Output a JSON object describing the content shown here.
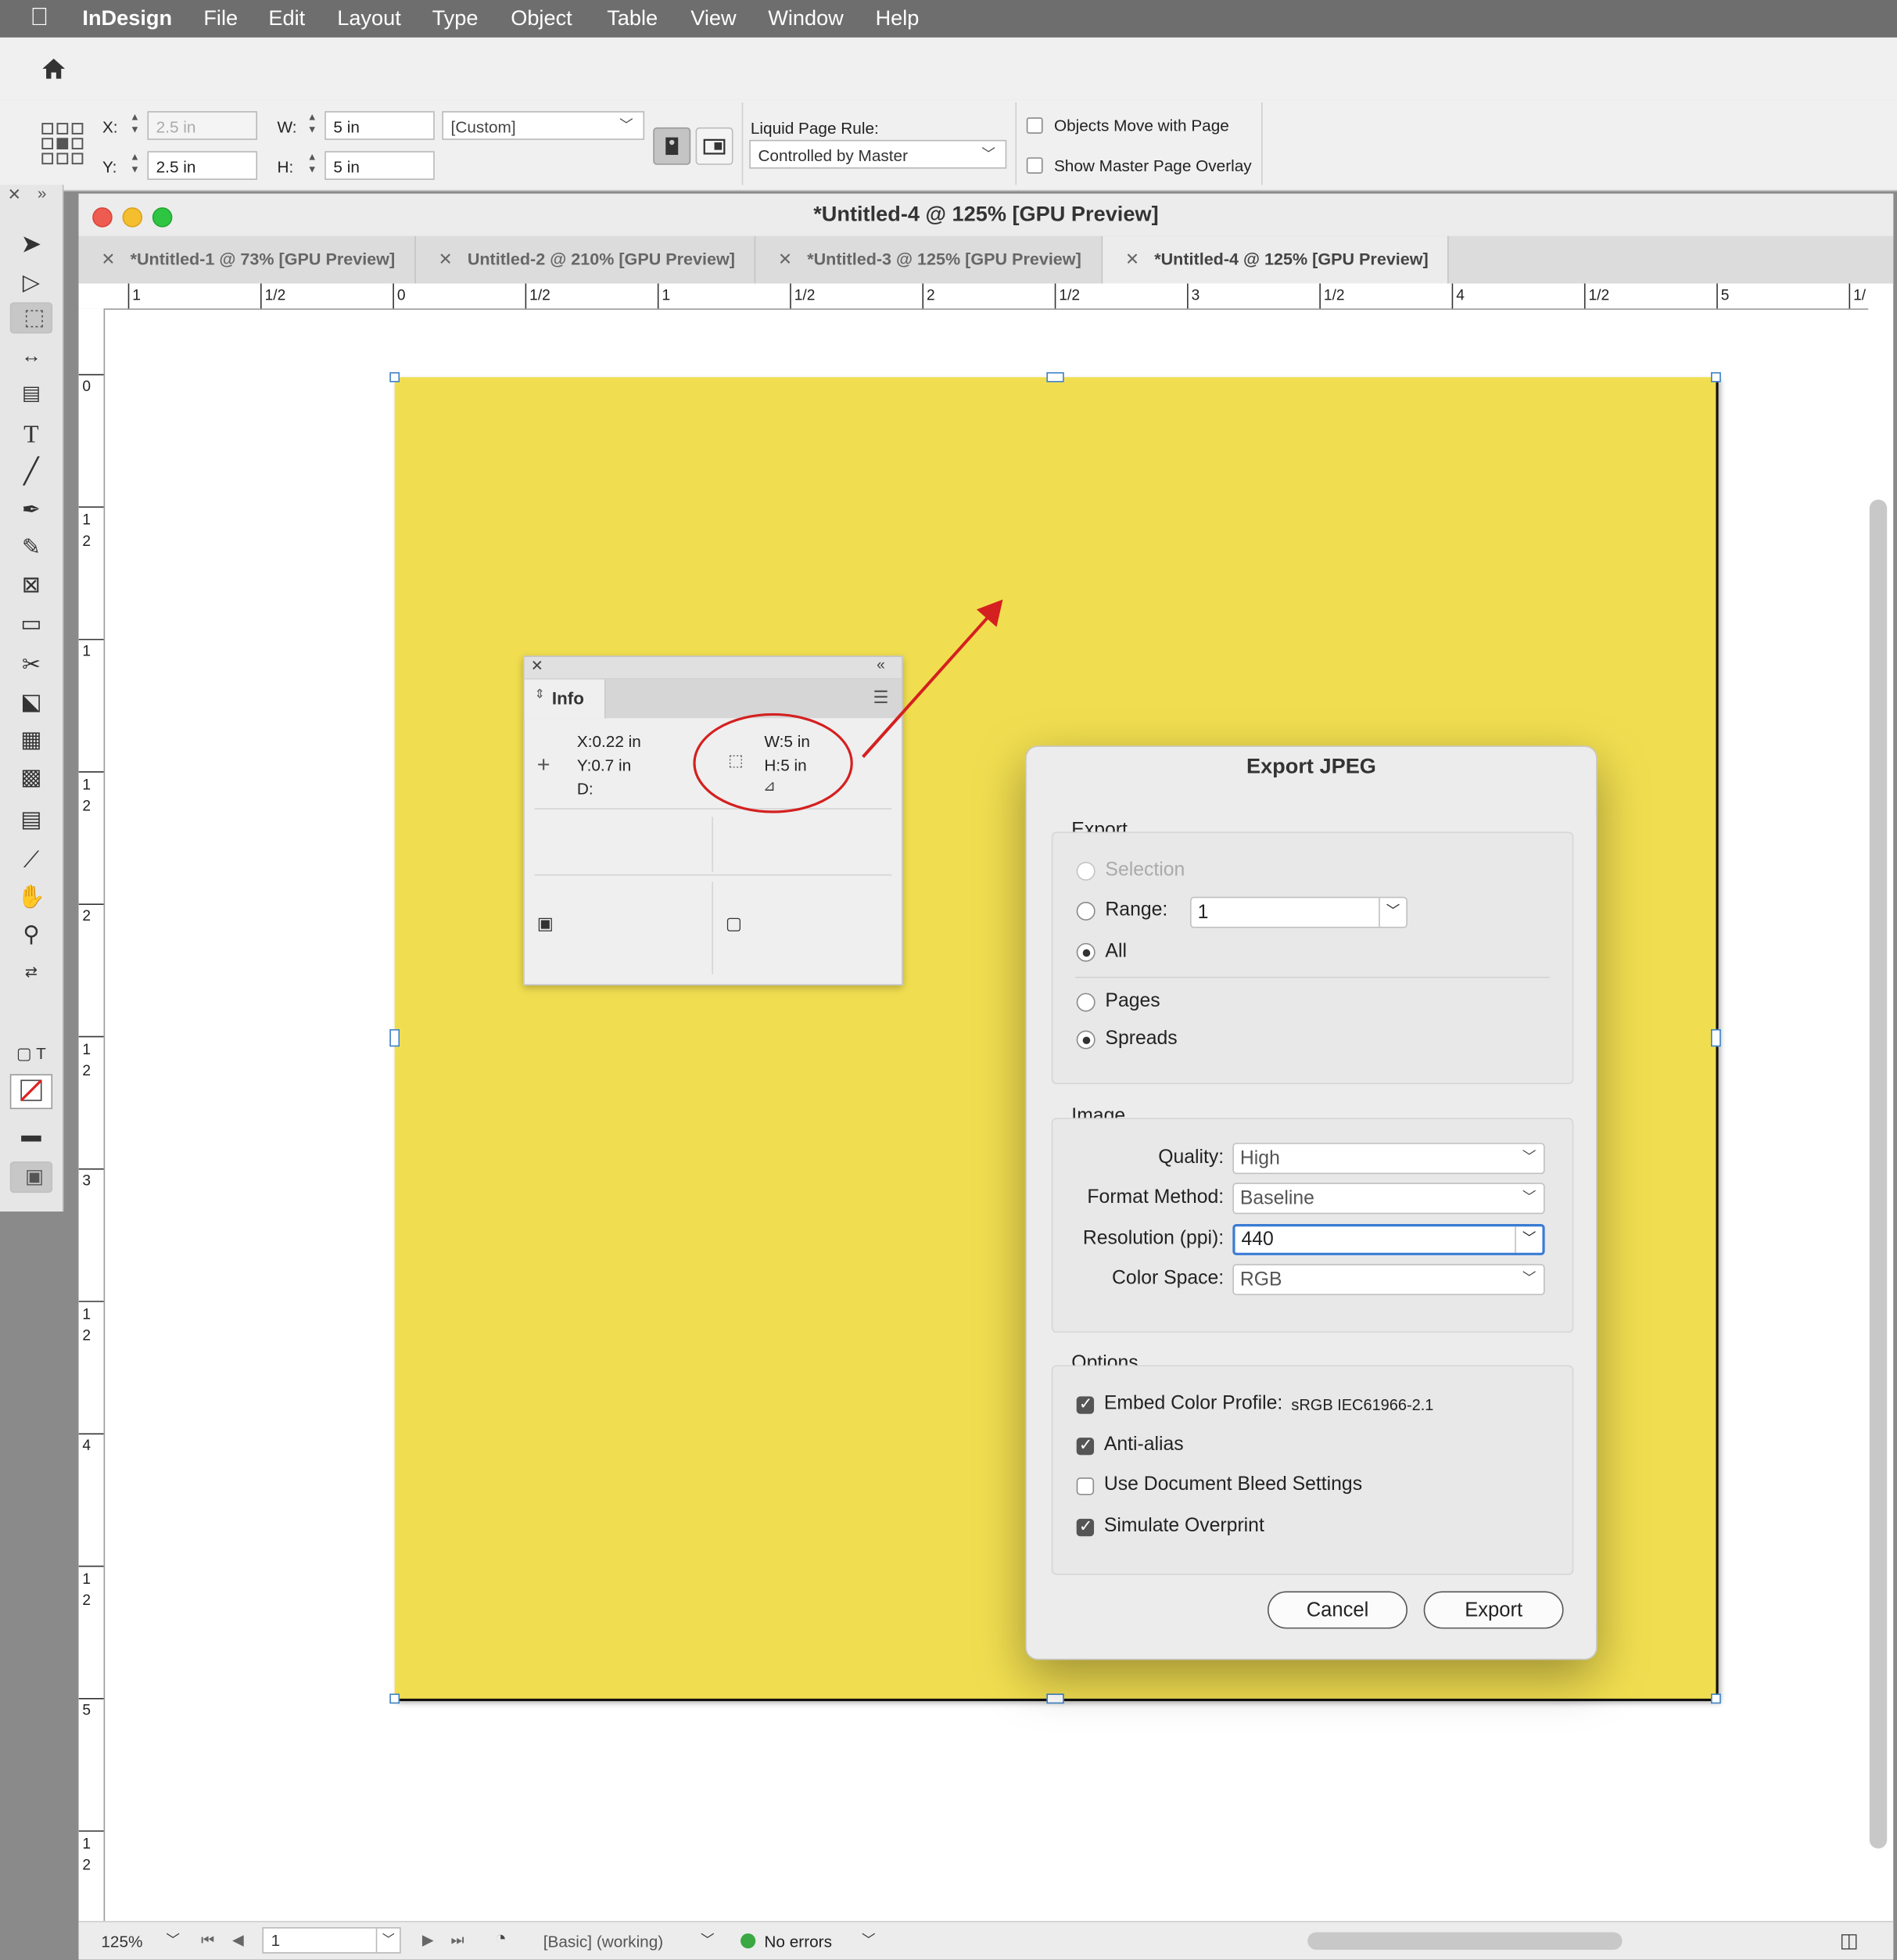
{
  "menubar": {
    "apple": "",
    "items": [
      "InDesign",
      "File",
      "Edit",
      "Layout",
      "Type",
      "Object",
      "Table",
      "View",
      "Window",
      "Help"
    ]
  },
  "controls": {
    "x_label": "X:",
    "x_value": "2.5 in",
    "y_label": "Y:",
    "y_value": "2.5 in",
    "w_label": "W:",
    "w_value": "5 in",
    "h_label": "H:",
    "h_value": "5 in",
    "size_preset": "[Custom]",
    "liquid_label": "Liquid Page Rule:",
    "liquid_value": "Controlled by Master",
    "objects_move": "Objects Move with Page",
    "show_overlay": "Show Master Page Overlay"
  },
  "window": {
    "title": "*Untitled-4 @ 125% [GPU Preview]",
    "tabs": [
      {
        "label": "*Untitled-1 @ 73% [GPU Preview]"
      },
      {
        "label": "Untitled-2 @ 210% [GPU Preview]"
      },
      {
        "label": "*Untitled-3 @ 125% [GPU Preview]"
      },
      {
        "label": "*Untitled-4 @ 125% [GPU Preview]"
      }
    ]
  },
  "ruler": {
    "h_labels": [
      "1",
      "1/2",
      "0",
      "1/2",
      "1",
      "1/2",
      "2",
      "1/2",
      "3",
      "1/2",
      "4",
      "1/2",
      "5",
      "1/"
    ],
    "v_labels": [
      "0",
      "1\n2",
      "1",
      "1\n2",
      "2",
      "1\n2",
      "3",
      "1\n2",
      "4",
      "1\n2",
      "5",
      "1\n2"
    ]
  },
  "info_panel": {
    "title": "Info",
    "x": "X:0.22 in",
    "y": "Y:0.7 in",
    "d": "D:",
    "w": "W:5 in",
    "h": "H:5 in"
  },
  "dialog": {
    "title": "Export JPEG",
    "export_group": "Export",
    "selection": "Selection",
    "range": "Range:",
    "range_value": "1",
    "all": "All",
    "pages": "Pages",
    "spreads": "Spreads",
    "image_group": "Image",
    "quality_label": "Quality:",
    "quality_value": "High",
    "format_label": "Format Method:",
    "format_value": "Baseline",
    "resolution_label": "Resolution (ppi):",
    "resolution_value": "440",
    "colorspace_label": "Color Space:",
    "colorspace_value": "RGB",
    "options_group": "Options",
    "embed_label": "Embed Color Profile:",
    "embed_value": "sRGB IEC61966-2.1",
    "antialias": "Anti-alias",
    "bleed": "Use Document Bleed Settings",
    "overprint": "Simulate Overprint",
    "cancel": "Cancel",
    "export": "Export"
  },
  "status": {
    "zoom": "125%",
    "page": "1",
    "profile": "[Basic] (working)",
    "errors": "No errors"
  },
  "colors": {
    "page_fill": "#f1de50",
    "annotation": "#d42020",
    "status_ok": "#3aa843"
  }
}
